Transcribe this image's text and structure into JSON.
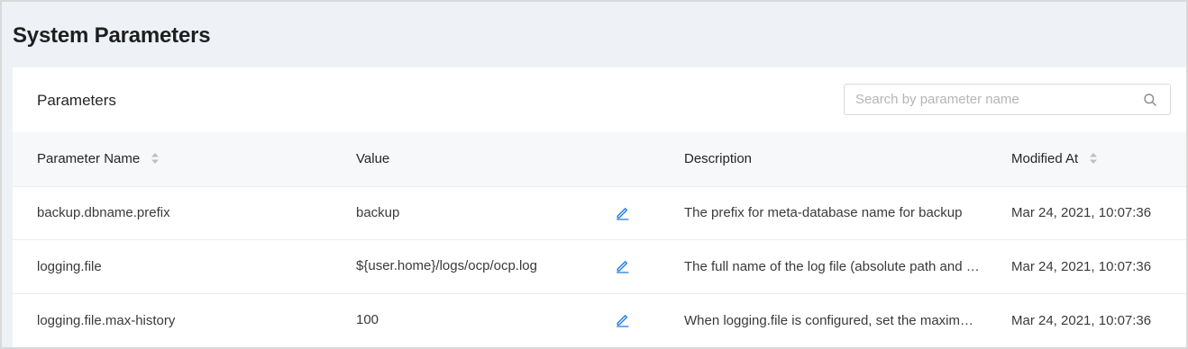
{
  "page": {
    "title": "System Parameters"
  },
  "card": {
    "title": "Parameters",
    "search": {
      "placeholder": "Search by parameter name",
      "value": "",
      "icon": "search-icon"
    }
  },
  "table": {
    "columns": [
      {
        "label": "Parameter Name",
        "sortable": true
      },
      {
        "label": "Value",
        "sortable": false
      },
      {
        "label": "Description",
        "sortable": false
      },
      {
        "label": "Modified At",
        "sortable": true
      }
    ],
    "rows": [
      {
        "name": "backup.dbname.prefix",
        "value": "backup",
        "description": "The prefix for meta-database name for backup",
        "modified": "Mar 24, 2021, 10:07:36"
      },
      {
        "name": "logging.file",
        "value": "${user.home}/logs/ocp/ocp.log",
        "description": "The full name of the log file (absolute path and file name)",
        "modified": "Mar 24, 2021, 10:07:36"
      },
      {
        "name": "logging.file.max-history",
        "value": "100",
        "description": "When logging.file is configured, set the maximum number of days to keep history logs",
        "modified": "Mar 24, 2021, 10:07:36"
      }
    ]
  },
  "colors": {
    "page_bg": "#eef1f5",
    "header_bg": "#f7f8fa",
    "accent": "#1f7ae0",
    "border": "#d9d9d9"
  }
}
